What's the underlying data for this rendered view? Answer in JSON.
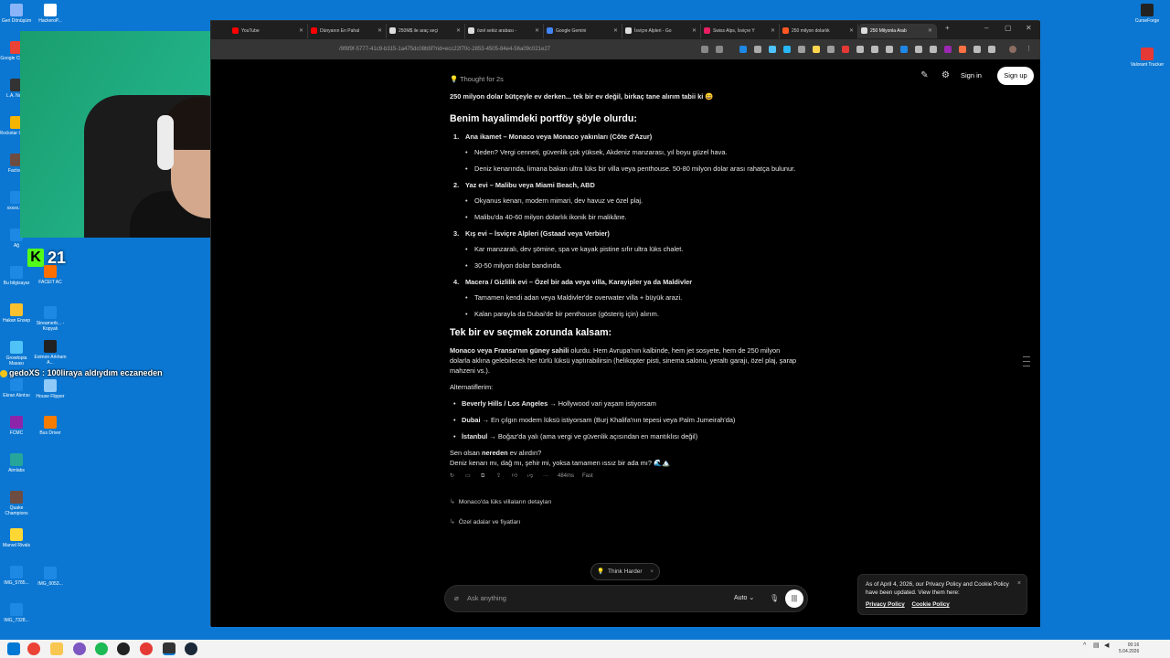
{
  "desktop": {
    "icons_left": [
      {
        "label": "Geri Dönüşüm",
        "color": "#8ab4f8"
      },
      {
        "label": "Google Chrome",
        "color": "#ea4335"
      },
      {
        "label": "L.A. Noire",
        "color": "#333333"
      },
      {
        "label": "Rockstar Games",
        "color": "#f4b400"
      },
      {
        "label": "Factorio",
        "color": "#6d4c41"
      },
      {
        "label": "xxxxx.P...",
        "color": "#1e88e5"
      },
      {
        "label": "Ağ",
        "color": "#1e88e5"
      },
      {
        "label": "Bu bilgisayar",
        "color": "#1e88e5"
      },
      {
        "label": "Hakan Ensep",
        "color": "#fbc02d"
      },
      {
        "label": "Growtopia Masası",
        "color": "#4fc3f7"
      },
      {
        "label": "Ekran Alıntısı",
        "color": "#1e88e5"
      },
      {
        "label": "FCMC",
        "color": "#8e24aa"
      },
      {
        "label": "Aimlabs",
        "color": "#26a69a"
      },
      {
        "label": "Quake Champions",
        "color": "#6d4c41"
      },
      {
        "label": "Marvel Rivals",
        "color": "#fdd835"
      },
      {
        "label": "IMG_5785...",
        "color": "#1e88e5"
      },
      {
        "label": "IMG_7328...",
        "color": "#1e88e5"
      }
    ],
    "icons_col2": [
      {
        "label": "HackeroP...",
        "color": "#ffffff"
      },
      {
        "label": "FACEIT AC",
        "color": "#ff6f00"
      },
      {
        "label": "Streamerb... - Kopyalı",
        "color": "#1e88e5"
      },
      {
        "label": "Eximon Arkham A...",
        "color": "#212121"
      },
      {
        "label": "House Flipper",
        "color": "#90caf9"
      },
      {
        "label": "Bus Driver",
        "color": "#f57c00"
      },
      {
        "label": "IMG_0053...",
        "color": "#1e88e5"
      }
    ],
    "icons_right": [
      {
        "label": "CurseForge",
        "color": "#222222"
      },
      {
        "label": "Valorant Tracker",
        "color": "#e53935"
      }
    ]
  },
  "overlay": {
    "kick_letter": "K",
    "viewer_count": "21",
    "chat_line": "gedoXS : 100liraya aldıydım eczaneden"
  },
  "browser": {
    "tabs": [
      {
        "title": "YouTube",
        "color": "#ff0000"
      },
      {
        "title": "Dünyanın En Pahal",
        "color": "#ff0000"
      },
      {
        "title": "250M$ ile araç seçi",
        "color": "#dddddd"
      },
      {
        "title": "özel sekiz arabası -",
        "color": "#dddddd"
      },
      {
        "title": "Google Gemini",
        "color": "#4285f4"
      },
      {
        "title": "İsviçre Alpleri - Go",
        "color": "#dddddd"
      },
      {
        "title": "Swiss Alps, İsviçre Y",
        "color": "#e91e63"
      },
      {
        "title": "250 milyon dolarlık",
        "color": "#ff5722"
      },
      {
        "title": "250 Milyonla Arab",
        "color": "#dddddd"
      }
    ],
    "url": "/9f8f9f-5777-41c9-b315-1a475dc08b5f?rid=ecc22f70c-2853-4505-84e4-56a09c021e27"
  },
  "header": {
    "sign_in": "Sign in",
    "sign_up": "Sign up"
  },
  "response": {
    "thought": "Thought for 2s",
    "intro": "250 milyon dolar bütçeyle ev derken... tek bir ev değil, birkaç tane alırım tabii ki 😄",
    "heading1": "Benim hayalimdeki portföy şöyle olurdu:",
    "items": [
      {
        "num": "1.",
        "title": "Ana ikamet – Monaco veya Monaco yakınları (Côte d'Azur)",
        "bullets": [
          "Neden? Vergi cenneti, güvenlik çok yüksek, Akdeniz manzarası, yıl boyu güzel hava.",
          "Deniz kenarında, limana bakan ultra lüks bir villa veya penthouse. 50-80 milyon dolar arası rahatça bulunur."
        ]
      },
      {
        "num": "2.",
        "title": "Yaz evi – Malibu veya Miami Beach, ABD",
        "bullets": [
          "Okyanus kenarı, modern mimari, dev havuz ve özel plaj.",
          "Malibu'da 40-60 milyon dolarlık ikonik bir malikâne."
        ]
      },
      {
        "num": "3.",
        "title": "Kış evi – İsviçre Alpleri (Gstaad veya Verbier)",
        "bullets": [
          "Kar manzaralı, dev şömine, spa ve kayak pistine sıfır ultra lüks chalet.",
          "30-50 milyon dolar bandında."
        ]
      },
      {
        "num": "4.",
        "title": "Macera / Gizlilik evi – Özel bir ada veya villa, Karayipler ya da Maldivler",
        "bullets": [
          "Tamamen kendi adan veya Maldivler'de overwater villa + büyük arazi.",
          "Kalan parayla da Dubai'de bir penthouse (gösteriş için) alırım."
        ]
      }
    ],
    "heading2": "Tek bir ev seçmek zorunda kalsam:",
    "single_bold": "Monaco veya Fransa'nın güney sahili",
    "single_rest": " olurdu. Hem Avrupa'nın kalbinde, hem jet sosyete, hem de 250 milyon dolarla aklına gelebilecek her türlü lüksü yaptırabilirsin (helikopter pisti, sinema salonu, yeraltı garajı, özel plaj, şarap mahzeni vs.).",
    "alt_label": "Alternatiflerim:",
    "alternatives": [
      {
        "bold": "Beverly Hills / Los Angeles",
        "rest": " → Hollywood vari yaşam istiyorsam"
      },
      {
        "bold": "Dubai",
        "rest": " → En çılgın modern lüksü istiyorsam (Burj Khalifa'nın tepesi veya Palm Jumeirah'da)"
      },
      {
        "bold": "İstanbul",
        "rest": " → Boğaz'da yalı (ama vergi ve güvenlik açısından en mantıklısı değil)"
      }
    ],
    "closing_pre": "Sen olsan ",
    "closing_bold": "nereden",
    "closing_post": " ev alırdın?",
    "closing2": "Deniz kenarı mı, dağ mı, şehir mi, yoksa tamamen ıssız bir ada mı? 🌊🏔️",
    "meta_time": "484ms",
    "meta_mode": "Fast",
    "followups": [
      "Monaco'da lüks villaların detayları",
      "Özel adalar ve fiyatları"
    ]
  },
  "composer": {
    "think_harder": "Think Harder",
    "placeholder": "Ask anything",
    "model": "Auto"
  },
  "cookie": {
    "text": "As of April 4, 2026, our Privacy Policy and Cookie Policy have been updated. View them here:",
    "privacy": "Privacy Policy",
    "cookie_policy": "Cookie Policy"
  },
  "taskbar": {
    "time": "00:16",
    "date": "5.04.2026"
  }
}
